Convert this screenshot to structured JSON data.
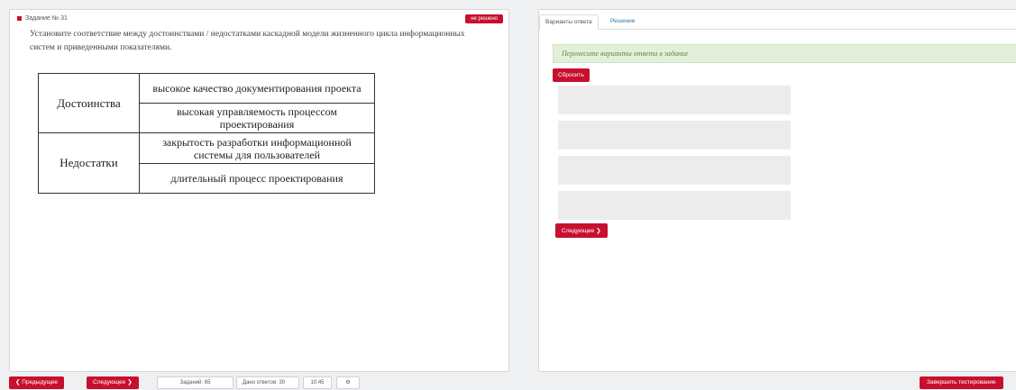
{
  "task": {
    "header": "Задание № 31",
    "to_show_label": "не решено",
    "question": "Установите соответствие между достоинствами / недостатками каскадной модели жизненного цикла информационных систем и приведенными показателями.",
    "table": [
      {
        "category": "Достоинства",
        "items": [
          "высокое качество документирования проекта",
          "высокая управляемость процессом проектирования"
        ]
      },
      {
        "category": "Недостатки",
        "items": [
          "закрытость разработки информационной системы для пользователей",
          "длительный процесс проектирования"
        ]
      }
    ]
  },
  "answer_panel": {
    "tabs": [
      "Варианты ответа",
      "Решение"
    ],
    "hint": "Перенесите варианты ответа в задание",
    "reset_label": "Сбросить",
    "next_label": "Следующее ❯"
  },
  "bottom_bar": {
    "prev_label": "❮ Предыдущее",
    "next_label": "Следующее ❯",
    "tasks_label": "Заданий: 65",
    "answered_label": "Дано ответов: 30",
    "time_label": "10:45",
    "settings_icon": "⚙",
    "finish_label": "Завершить тестирование"
  },
  "colors": {
    "accent": "#c8102e",
    "hint_bg": "#e3f0d9",
    "hint_text": "#5b8a3a"
  }
}
